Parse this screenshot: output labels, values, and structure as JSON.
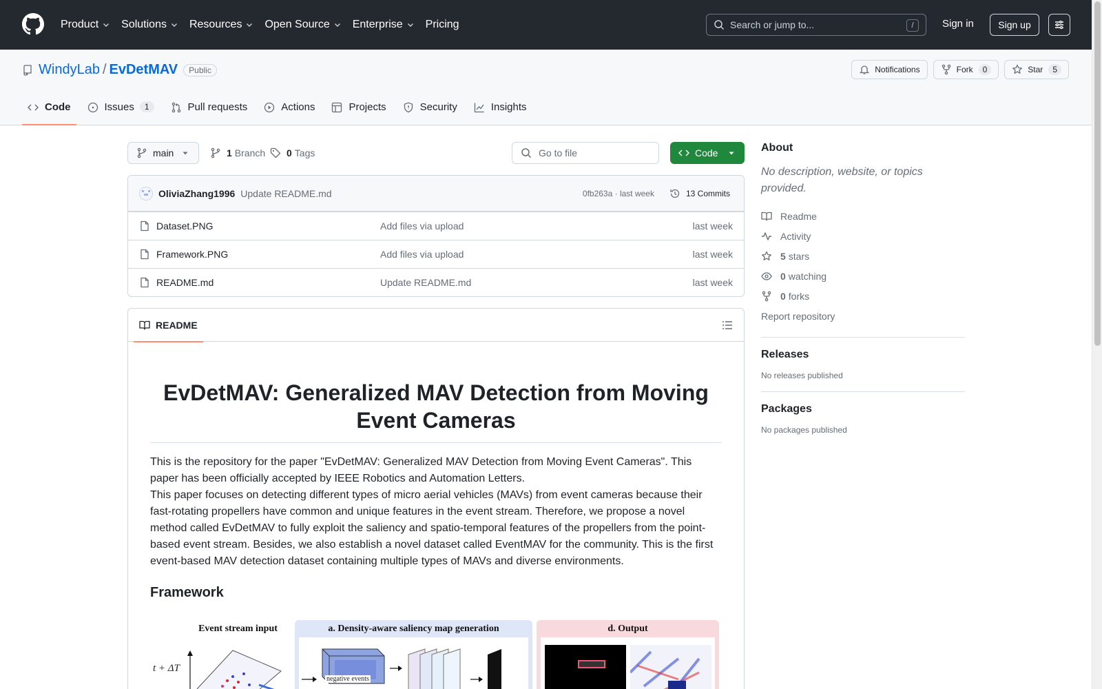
{
  "header": {
    "nav": [
      {
        "label": "Product",
        "has_menu": true
      },
      {
        "label": "Solutions",
        "has_menu": true
      },
      {
        "label": "Resources",
        "has_menu": true
      },
      {
        "label": "Open Source",
        "has_menu": true
      },
      {
        "label": "Enterprise",
        "has_menu": true
      },
      {
        "label": "Pricing",
        "has_menu": false
      }
    ],
    "search_placeholder": "Search or jump to...",
    "search_shortcut": "/",
    "sign_in": "Sign in",
    "sign_up": "Sign up"
  },
  "repo": {
    "owner": "WindyLab",
    "separator": "/",
    "name": "EvDetMAV",
    "visibility": "Public",
    "actions": {
      "notifications": "Notifications",
      "fork": "Fork",
      "fork_count": "0",
      "star": "Star",
      "star_count": "5"
    },
    "tabs": [
      {
        "label": "Code",
        "icon": "code-icon",
        "active": true
      },
      {
        "label": "Issues",
        "icon": "issue-icon",
        "count": "1"
      },
      {
        "label": "Pull requests",
        "icon": "pull-request-icon"
      },
      {
        "label": "Actions",
        "icon": "play-icon"
      },
      {
        "label": "Projects",
        "icon": "table-icon"
      },
      {
        "label": "Security",
        "icon": "shield-icon"
      },
      {
        "label": "Insights",
        "icon": "graph-icon"
      }
    ]
  },
  "toolbar": {
    "branch": "main",
    "branch_count": "1",
    "branch_label": "Branch",
    "tag_count": "0",
    "tag_label": "Tags",
    "go_to_file": "Go to file",
    "code_button": "Code"
  },
  "commit": {
    "author": "OliviaZhang1996",
    "message": "Update README.md",
    "hash": "0fb263a",
    "time": "last week",
    "commits_count": "13 Commits"
  },
  "files": [
    {
      "name": "Dataset.PNG",
      "message": "Add files via upload",
      "date": "last week"
    },
    {
      "name": "Framework.PNG",
      "message": "Add files via upload",
      "date": "last week"
    },
    {
      "name": "README.md",
      "message": "Update README.md",
      "date": "last week"
    }
  ],
  "readme": {
    "tab_label": "README",
    "title": "EvDetMAV: Generalized MAV Detection from Moving Event Cameras",
    "paragraph1": "This is the repository for the paper \"EvDetMAV: Generalized MAV Detection from Moving Event Cameras\". This paper has been officially accepted by IEEE Robotics and Automation Letters.",
    "paragraph2": "This paper focuses on detecting different types of micro aerial vehicles (MAVs) from event cameras because their fast-rotating propellers have common and unique features in the event stream. Therefore, we propose a novel method called EvDetMAV to fully exploit the saliency and spatio-temporal features of the propellers from the point-based event stream. Besides, we also establish a novel dataset called EventMAV for the community. This is the first event-based MAV detection dataset containing multiple types of MAVs and diverse environments.",
    "framework_heading": "Framework",
    "figure": {
      "input_title": "Event stream input",
      "axis_label": "t + ΔT",
      "block_a_title": "a. Density-aware saliency map generation",
      "block_a_inner": "negative events",
      "block_d_title": "d. Output"
    }
  },
  "sidebar": {
    "about_title": "About",
    "about_desc": "No description, website, or topics provided.",
    "links": [
      {
        "icon": "book-icon",
        "count": "",
        "label": "Readme"
      },
      {
        "icon": "pulse-icon",
        "count": "",
        "label": "Activity"
      },
      {
        "icon": "star-icon",
        "count": "5",
        "label": "stars"
      },
      {
        "icon": "eye-icon",
        "count": "0",
        "label": "watching"
      },
      {
        "icon": "fork-icon",
        "count": "0",
        "label": "forks"
      }
    ],
    "report": "Report repository",
    "releases_title": "Releases",
    "releases_empty": "No releases published",
    "packages_title": "Packages",
    "packages_empty": "No packages published"
  },
  "colors": {
    "header_bg": "#24292f",
    "link": "#0969da",
    "primary_button": "#1f883d",
    "active_tab_underline": "#fd8c73"
  }
}
